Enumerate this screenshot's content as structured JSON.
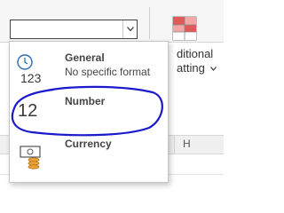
{
  "ribbon": {
    "format_combo": {
      "value": ""
    },
    "conditional_formatting": {
      "label_line1": "ditional",
      "label_line2": "atting"
    }
  },
  "dropdown": {
    "items": [
      {
        "icon": "clock-123-icon",
        "title": "General",
        "subtitle": "No specific format"
      },
      {
        "icon": "number-12-icon",
        "glyph": "12",
        "title": "Number",
        "subtitle": ""
      },
      {
        "icon": "currency-icon",
        "title": "Currency",
        "subtitle": ""
      }
    ]
  },
  "sheet": {
    "column_header": "H"
  },
  "annotation": {
    "color": "#1a1acc",
    "description": "hand-drawn circle around Number"
  },
  "colors": {
    "accent": "#1a1acc",
    "icon_blue": "#2b6cb0",
    "icon_orange": "#e8a23a"
  }
}
